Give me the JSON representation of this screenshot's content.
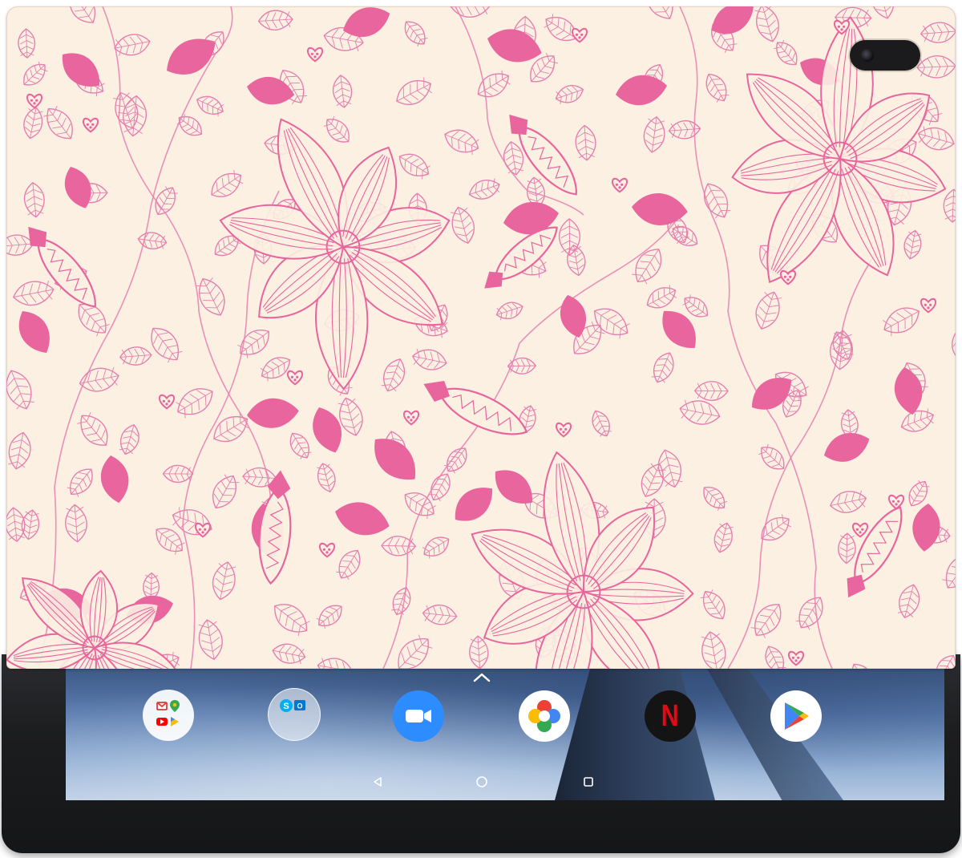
{
  "device": {
    "type": "tablet",
    "cover_pattern": "pink-floral-lily-pattern",
    "cover_colors": {
      "background": "#fbf0e2",
      "outline": "#e57fb0",
      "filled_leaf": "#e8659d"
    }
  },
  "dock": {
    "apps": [
      {
        "icon": "google-apps-folder-icon"
      },
      {
        "icon": "skype-outlook-folder-icon"
      },
      {
        "icon": "zoom-icon"
      },
      {
        "icon": "photos-icon"
      },
      {
        "icon": "netflix-icon",
        "label": "N"
      },
      {
        "icon": "play-store-icon"
      }
    ],
    "expand_icon": "chevron-up-icon"
  },
  "navigation_bar": {
    "buttons": [
      {
        "icon": "back-icon"
      },
      {
        "icon": "home-icon"
      },
      {
        "icon": "recents-icon"
      }
    ]
  },
  "colors": {
    "zoom_blue": "#2d8cff",
    "netflix_red": "#e50914",
    "play_green": "#34a853",
    "play_blue": "#4285f4",
    "play_yellow": "#fbbc04",
    "play_red": "#ea4335"
  }
}
